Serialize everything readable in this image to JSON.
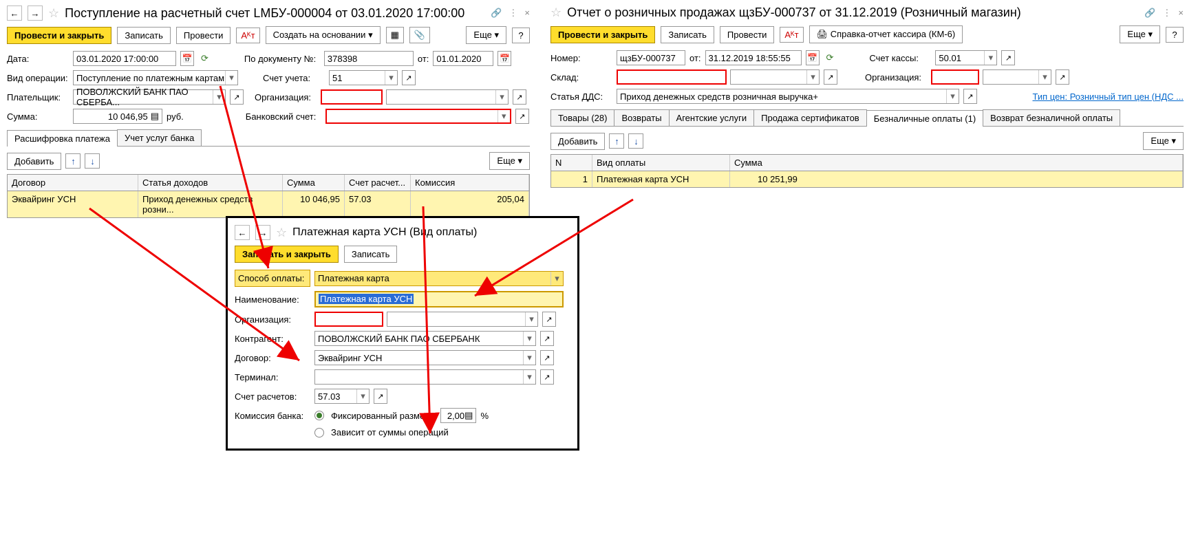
{
  "left": {
    "title": "Поступление на расчетный счет LМБУ-000004 от 03.01.2020 17:00:00",
    "toolbar": {
      "post_close": "Провести и закрыть",
      "write": "Записать",
      "post": "Провести",
      "create_based": "Создать на основании",
      "more": "Еще"
    },
    "date_lbl": "Дата:",
    "date": "03.01.2020 17:00:00",
    "doc_lbl": "По документу №:",
    "doc_no": "378398",
    "from_lbl": "от:",
    "doc_from": "01.01.2020",
    "op_lbl": "Вид операции:",
    "op_val": "Поступление по платежным картам",
    "acct_lbl": "Счет учета:",
    "acct_val": "51",
    "payer_lbl": "Плательщик:",
    "payer_val": "ПОВОЛЖСКИЙ БАНК ПАО СБЕРБА...",
    "org_lbl": "Организация:",
    "sum_lbl": "Сумма:",
    "sum_val": "10 046,95",
    "sum_cur": "руб.",
    "bank_lbl": "Банковский счет:",
    "tabs": {
      "detail": "Расшифровка платежа",
      "bank_svc": "Учет услуг банка"
    },
    "add": "Добавить",
    "more2": "Еще",
    "cols": {
      "contract": "Договор",
      "income": "Статья доходов",
      "sum": "Сумма",
      "acct": "Счет расчет...",
      "comm": "Комиссия"
    },
    "row": {
      "contract": "Эквайринг УСН",
      "income": "Приход денежных средств розни...",
      "sum": "10 046,95",
      "acct": "57.03",
      "comm": "205,04"
    }
  },
  "right": {
    "title": "Отчет о розничных продажах щзБУ-000737 от 31.12.2019 (Розничный магазин)",
    "toolbar": {
      "post_close": "Провести и закрыть",
      "write": "Записать",
      "post": "Провести",
      "report": "Справка-отчет кассира (КМ-6)",
      "more": "Еще"
    },
    "num_lbl": "Номер:",
    "num": "щзБУ-000737",
    "from_lbl": "от:",
    "date": "31.12.2019 18:55:55",
    "cash_lbl": "Счет кассы:",
    "cash_val": "50.01",
    "wh_lbl": "Склад:",
    "org_lbl": "Организация:",
    "dds_lbl": "Статья ДДС:",
    "dds_val": "Приход денежных средств розничная выручка+",
    "price_link": "Тип цен: Розничный тип цен (НДС ...",
    "tabs": {
      "goods": "Товары (28)",
      "returns": "Возвраты",
      "agent": "Агентские услуги",
      "cert": "Продажа сертификатов",
      "cashless": "Безналичные оплаты (1)",
      "ret_cashless": "Возврат безналичной оплаты"
    },
    "add": "Добавить",
    "more2": "Еще",
    "cols": {
      "n": "N",
      "type": "Вид оплаты",
      "sum": "Сумма"
    },
    "row": {
      "n": "1",
      "type": "Платежная карта УСН",
      "sum": "10 251,99"
    }
  },
  "popup": {
    "title": "Платежная карта УСН (Вид оплаты)",
    "write_close": "Записать и закрыть",
    "write": "Записать",
    "method_lbl": "Способ оплаты:",
    "method_val": "Платежная карта",
    "name_lbl": "Наименование:",
    "name_val": "Платежная карта УСН",
    "org_lbl": "Организация:",
    "ctr_lbl": "Контрагент:",
    "ctr_val": "ПОВОЛЖСКИЙ БАНК ПАО СБЕРБАНК",
    "contract_lbl": "Договор:",
    "contract_val": "Эквайринг УСН",
    "term_lbl": "Терминал:",
    "acct_lbl": "Счет расчетов:",
    "acct_val": "57.03",
    "comm_lbl": "Комиссия банка:",
    "comm_fixed": "Фиксированный размер",
    "comm_val": "2,00",
    "comm_pct": "%",
    "comm_dep": "Зависит от суммы операций"
  }
}
